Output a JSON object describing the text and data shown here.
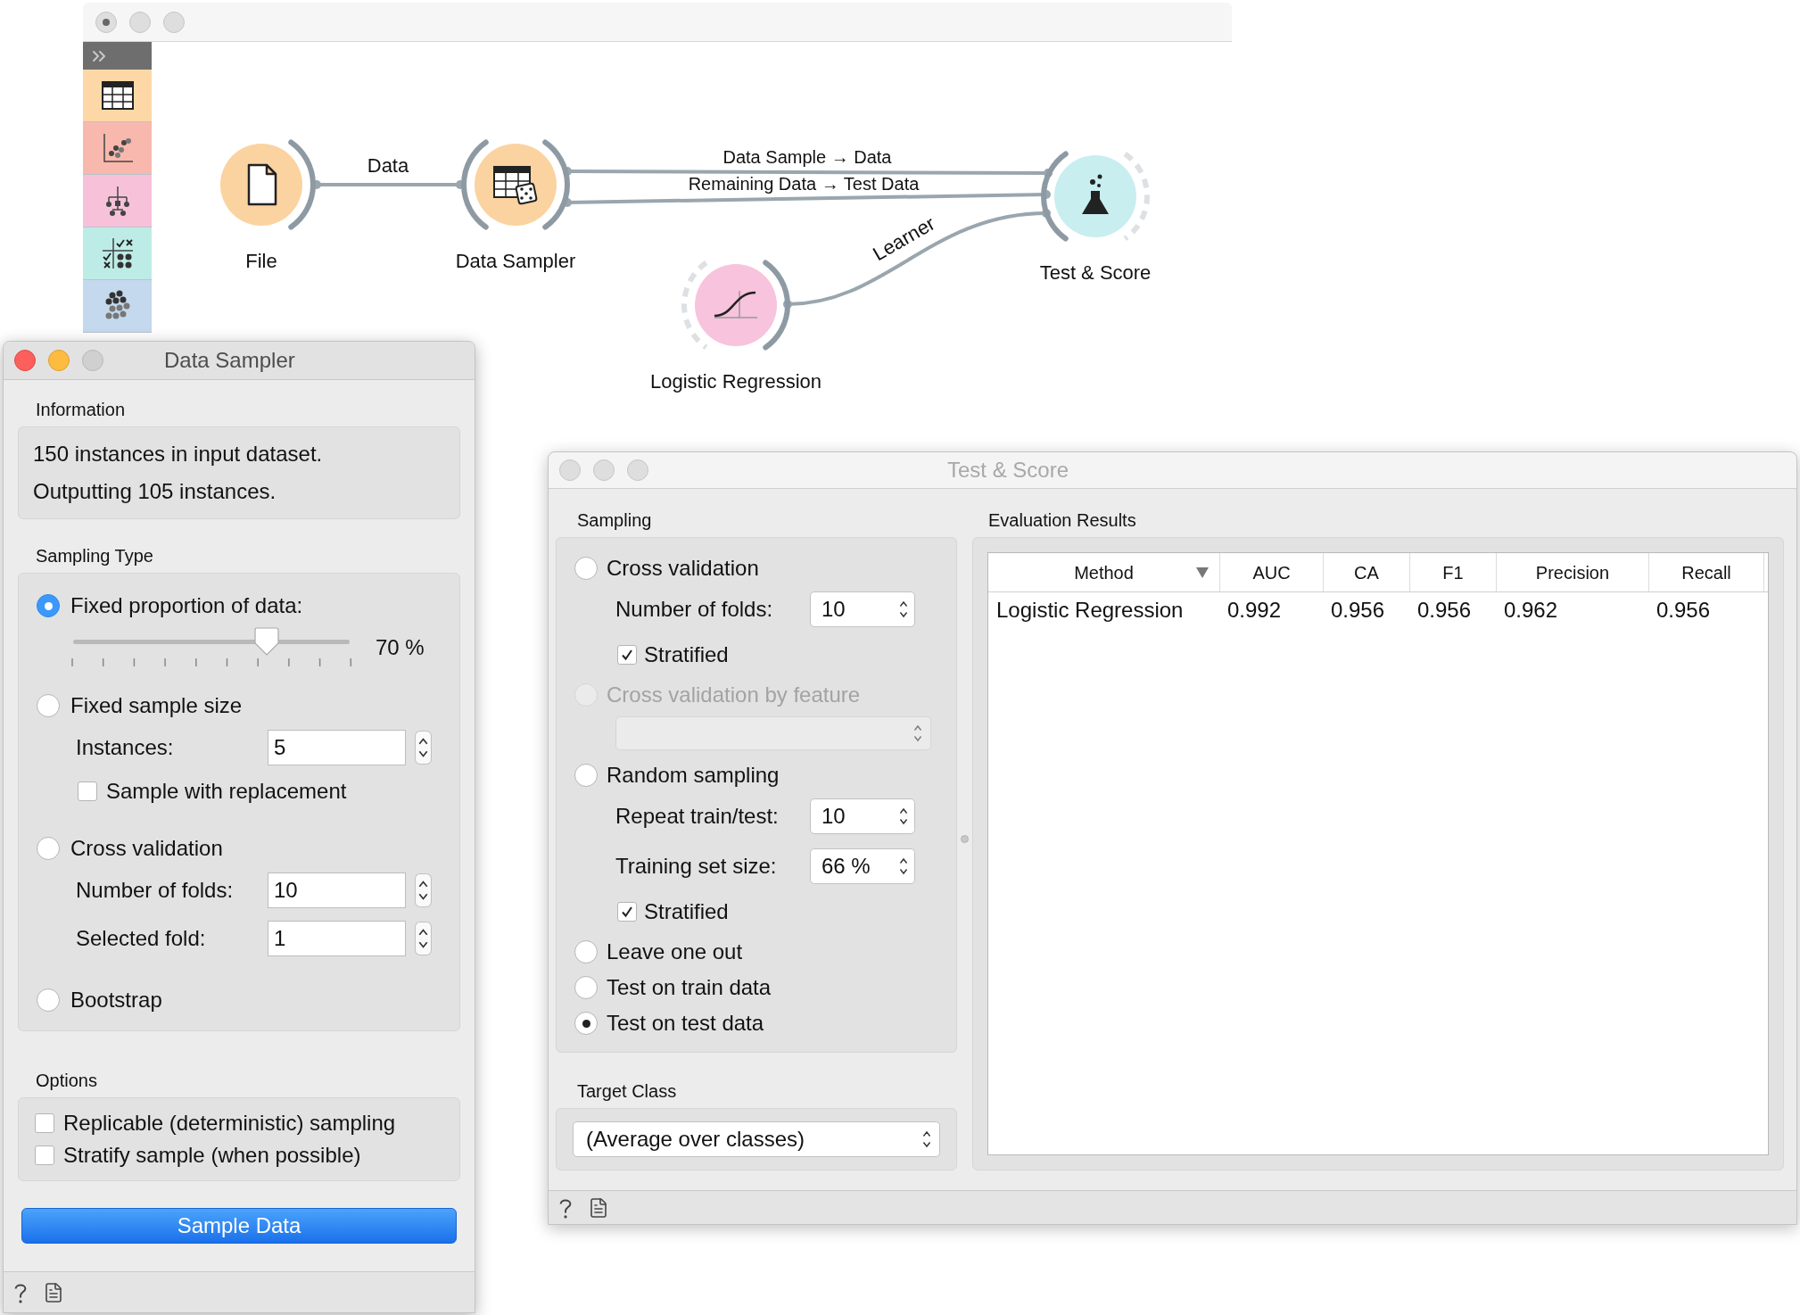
{
  "workflow_window": {
    "active": false,
    "edited": true,
    "toolbox": [
      {
        "kind": "table",
        "color": "#fdd8a6"
      },
      {
        "kind": "scatter",
        "color": "#f9b8ad"
      },
      {
        "kind": "tree",
        "color": "#f7c2d9"
      },
      {
        "kind": "matrix",
        "color": "#bdece6"
      },
      {
        "kind": "clusters",
        "color": "#c4d9ee"
      }
    ],
    "nodes": [
      {
        "kind": "file",
        "label": "File",
        "color": "#fbd3a0",
        "output_connected": true
      },
      {
        "kind": "sampler",
        "label": "Data Sampler",
        "color": "#fbd3a0",
        "input_connected": true,
        "output_connected": true
      },
      {
        "kind": "test",
        "label": "Test & Score",
        "color": "#c8eef0",
        "input_connected": true,
        "output_connected": false
      },
      {
        "kind": "logistic",
        "label": "Logistic Regression",
        "color": "#f8c3dc",
        "input_connected": false,
        "output_connected": true
      }
    ],
    "links": [
      {
        "label": "Data"
      },
      {
        "label": "Data Sample → Data"
      },
      {
        "label": "Remaining Data → Test Data"
      },
      {
        "label": "Learner"
      }
    ]
  },
  "data_sampler_window": {
    "title": "Data Sampler",
    "active": true,
    "information": {
      "heading": "Information",
      "lines": [
        "150 instances in input dataset.",
        "Outputting 105 instances."
      ]
    },
    "sampling_type": {
      "heading": "Sampling Type",
      "options": [
        {
          "label": "Fixed proportion of data:",
          "selected": true,
          "slider": {
            "level": 0.7,
            "reading": "70 %"
          }
        },
        {
          "label": "Fixed sample size",
          "selected": false,
          "fields": [
            {
              "label": "Instances:",
              "value": "5"
            }
          ],
          "checkboxes": [
            {
              "label": "Sample with replacement",
              "checked": false
            }
          ]
        },
        {
          "label": "Cross validation",
          "selected": false,
          "fields": [
            {
              "label": "Number of folds:",
              "value": "10"
            },
            {
              "label": "Selected fold:",
              "value": "1"
            }
          ]
        },
        {
          "label": "Bootstrap",
          "selected": false
        }
      ]
    },
    "options": {
      "heading": "Options",
      "checkboxes": [
        {
          "label": "Replicable (deterministic) sampling",
          "checked": false
        },
        {
          "label": "Stratify sample (when possible)",
          "checked": false
        }
      ]
    },
    "button": "Sample Data"
  },
  "test_score_window": {
    "title": "Test & Score",
    "active": false,
    "sampling": {
      "heading": "Sampling",
      "options": [
        {
          "label": "Cross validation",
          "selected": false,
          "disabled": false,
          "fields": [
            {
              "kind": "spin",
              "label": "Number of folds:",
              "value": "10"
            }
          ],
          "checkboxes": [
            {
              "label": "Stratified",
              "checked": true
            }
          ]
        },
        {
          "label": "Cross validation by feature",
          "selected": false,
          "disabled": true,
          "fields": [
            {
              "kind": "combo"
            }
          ]
        },
        {
          "label": "Random sampling",
          "selected": false,
          "disabled": false,
          "fields": [
            {
              "kind": "spin",
              "label": "Repeat train/test:",
              "value": "10"
            },
            {
              "kind": "spin",
              "label": "Training set size:",
              "value": "66 %"
            }
          ],
          "checkboxes": [
            {
              "label": "Stratified",
              "checked": true
            }
          ]
        },
        {
          "label": "Leave one out",
          "selected": false,
          "disabled": false
        },
        {
          "label": "Test on train data",
          "selected": false,
          "disabled": false
        },
        {
          "label": "Test on test data",
          "selected": true,
          "disabled": false
        }
      ]
    },
    "target_class": {
      "heading": "Target Class",
      "value": "(Average over classes)"
    },
    "evaluation": {
      "heading": "Evaluation Results",
      "columns": [
        {
          "label": "Method",
          "sorted": true
        },
        {
          "label": "AUC",
          "sorted": false
        },
        {
          "label": "CA",
          "sorted": false
        },
        {
          "label": "F1",
          "sorted": false
        },
        {
          "label": "Precision",
          "sorted": false
        },
        {
          "label": "Recall",
          "sorted": false
        }
      ],
      "rows": [
        [
          "Logistic Regression",
          "0.992",
          "0.956",
          "0.956",
          "0.962",
          "0.956"
        ]
      ]
    }
  }
}
